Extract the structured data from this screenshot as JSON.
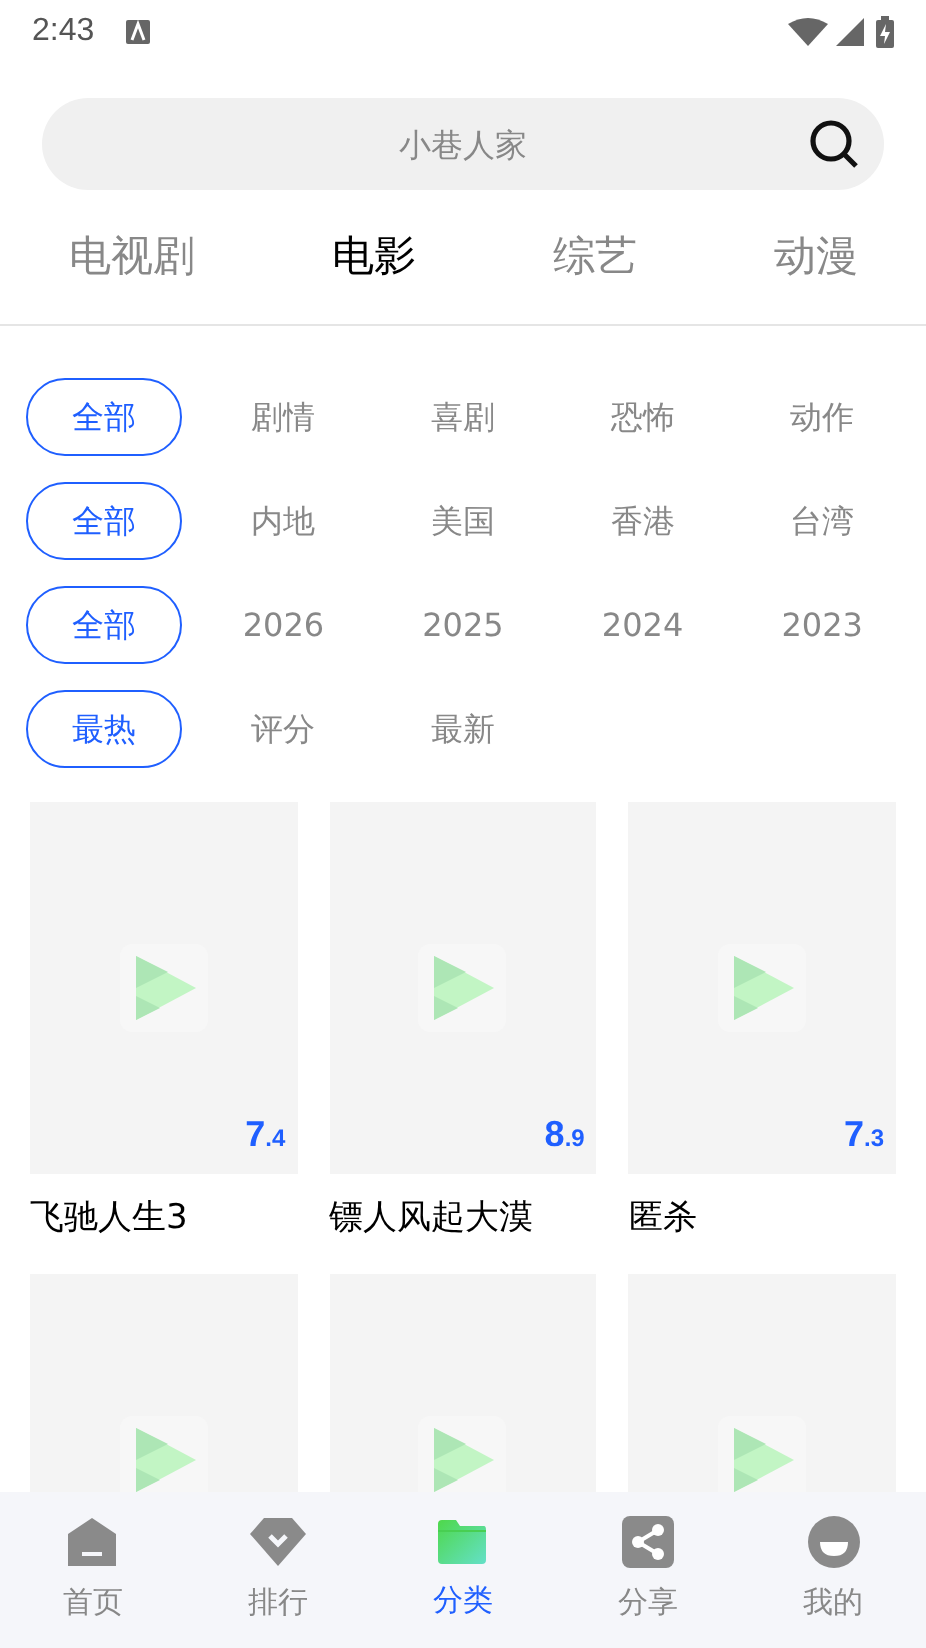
{
  "status_bar": {
    "time": "2:43"
  },
  "search": {
    "placeholder": "小巷人家"
  },
  "tabs": [
    {
      "label": "电视剧",
      "selected": false
    },
    {
      "label": "电影",
      "selected": true
    },
    {
      "label": "综艺",
      "selected": false
    },
    {
      "label": "动漫",
      "selected": false
    }
  ],
  "filters": [
    {
      "options": [
        {
          "label": "全部",
          "selected": true
        },
        {
          "label": "剧情",
          "selected": false
        },
        {
          "label": "喜剧",
          "selected": false
        },
        {
          "label": "恐怖",
          "selected": false
        },
        {
          "label": "动作",
          "selected": false
        }
      ]
    },
    {
      "options": [
        {
          "label": "全部",
          "selected": true
        },
        {
          "label": "内地",
          "selected": false
        },
        {
          "label": "美国",
          "selected": false
        },
        {
          "label": "香港",
          "selected": false
        },
        {
          "label": "台湾",
          "selected": false
        }
      ]
    },
    {
      "options": [
        {
          "label": "全部",
          "selected": true
        },
        {
          "label": "2026",
          "selected": false
        },
        {
          "label": "2025",
          "selected": false
        },
        {
          "label": "2024",
          "selected": false
        },
        {
          "label": "2023",
          "selected": false
        }
      ]
    },
    {
      "options": [
        {
          "label": "最热",
          "selected": true
        },
        {
          "label": "评分",
          "selected": false
        },
        {
          "label": "最新",
          "selected": false
        }
      ]
    }
  ],
  "movies": [
    {
      "kind": "poster",
      "title": "飞驰人生3",
      "score": "7",
      "score_decimal": ".4"
    },
    {
      "kind": "poster",
      "title": "镖人风起大漠",
      "score": "8",
      "score_decimal": ".9"
    },
    {
      "kind": "poster",
      "title": "匿杀",
      "score": "7",
      "score_decimal": ".3"
    },
    {
      "kind": "poster"
    },
    {
      "kind": "poster"
    },
    {
      "kind": "poster"
    }
  ],
  "bottom_nav": [
    {
      "label": "首页",
      "kind": "home",
      "selected": false
    },
    {
      "label": "排行",
      "kind": "rank",
      "selected": false
    },
    {
      "label": "分类",
      "kind": "category",
      "selected": true
    },
    {
      "label": "分享",
      "kind": "share",
      "selected": false
    },
    {
      "label": "我的",
      "kind": "me",
      "selected": false
    }
  ]
}
